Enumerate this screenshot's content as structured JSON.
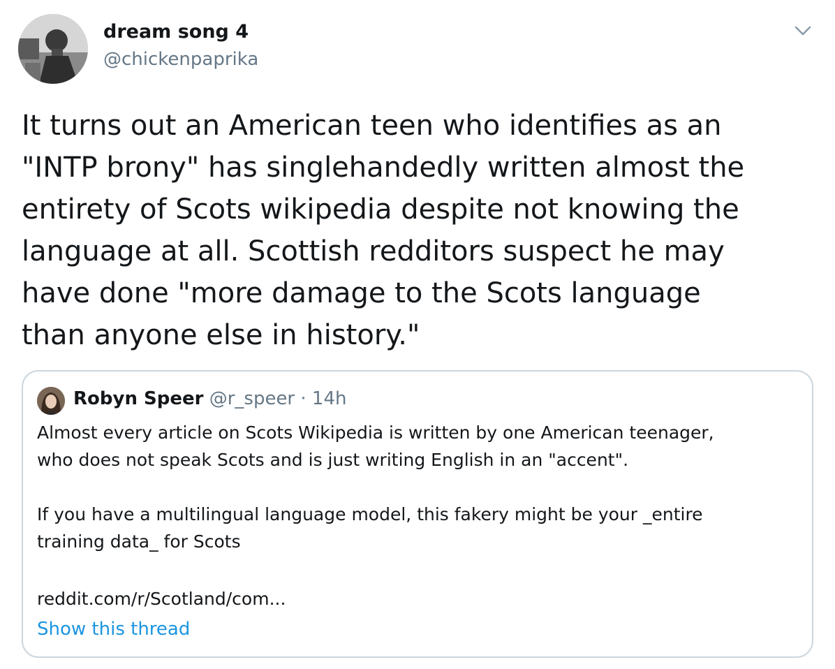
{
  "author": {
    "display_name": "dream song 4",
    "handle": "@chickenpaprika",
    "avatar_icon": "profile-photo"
  },
  "menu": {
    "icon": "chevron-down-icon"
  },
  "tweet": {
    "text": "It turns out an American teen who identifies as an\n\"INTP brony\" has singlehandedly written almost the\nentirety of Scots wikipedia despite not knowing the\nlanguage at all. Scottish redditors suspect he may\nhave done \"more damage to the Scots language\nthan anyone else in history.\""
  },
  "quoted_tweet": {
    "author_name": "Robyn Speer",
    "handle": "@r_speer",
    "separator": " · ",
    "time": "14h",
    "avatar_icon": "profile-photo",
    "body": "Almost every article on Scots Wikipedia is written by one American teenager,\nwho does not speak Scots and is just writing English in an \"accent\".\n\nIf you have a multilingual language model, this fakery might be your _entire\ntraining data_ for Scots",
    "link": "reddit.com/r/Scotland/com...",
    "show_thread": "Show this thread"
  },
  "colors": {
    "text": "#14171a",
    "secondary": "#657786",
    "link": "#1b95e0",
    "border": "#ccd6dd",
    "background": "#ffffff"
  }
}
